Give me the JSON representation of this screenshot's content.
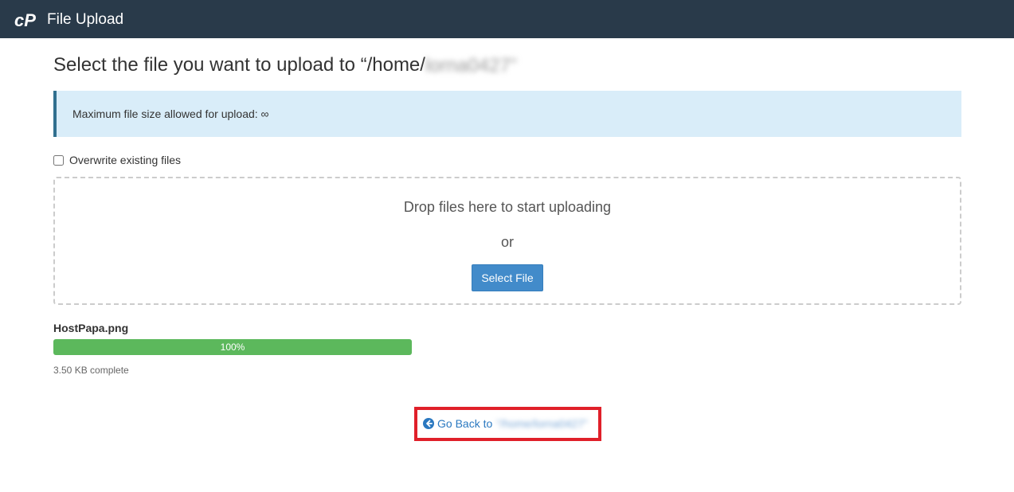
{
  "header": {
    "app_title": "File Upload",
    "logo_text": "cP"
  },
  "page": {
    "title": "Select the file you want to upload to “/home/",
    "title_path_blurred": "lorna0427”"
  },
  "info": {
    "max_size_text": "Maximum file size allowed for upload: ∞"
  },
  "options": {
    "overwrite_label": "Overwrite existing files",
    "overwrite_checked": false
  },
  "dropzone": {
    "drop_text": "Drop files here to start uploading",
    "or_text": "or",
    "select_button_label": "Select File"
  },
  "upload": {
    "file_name": "HostPapa.png",
    "progress_percent": 100,
    "progress_label": "100%",
    "status_text": "3.50 KB complete",
    "progress_color": "#5cb85c"
  },
  "back": {
    "label": "Go Back to",
    "path_blurred": "“/home/lorna0427”",
    "icon": "arrow-circle-left-icon"
  },
  "colors": {
    "header_bg": "#293a4a",
    "alert_bg": "#d9edf9",
    "button_bg": "#428bca",
    "highlight_border": "#e0202a"
  }
}
